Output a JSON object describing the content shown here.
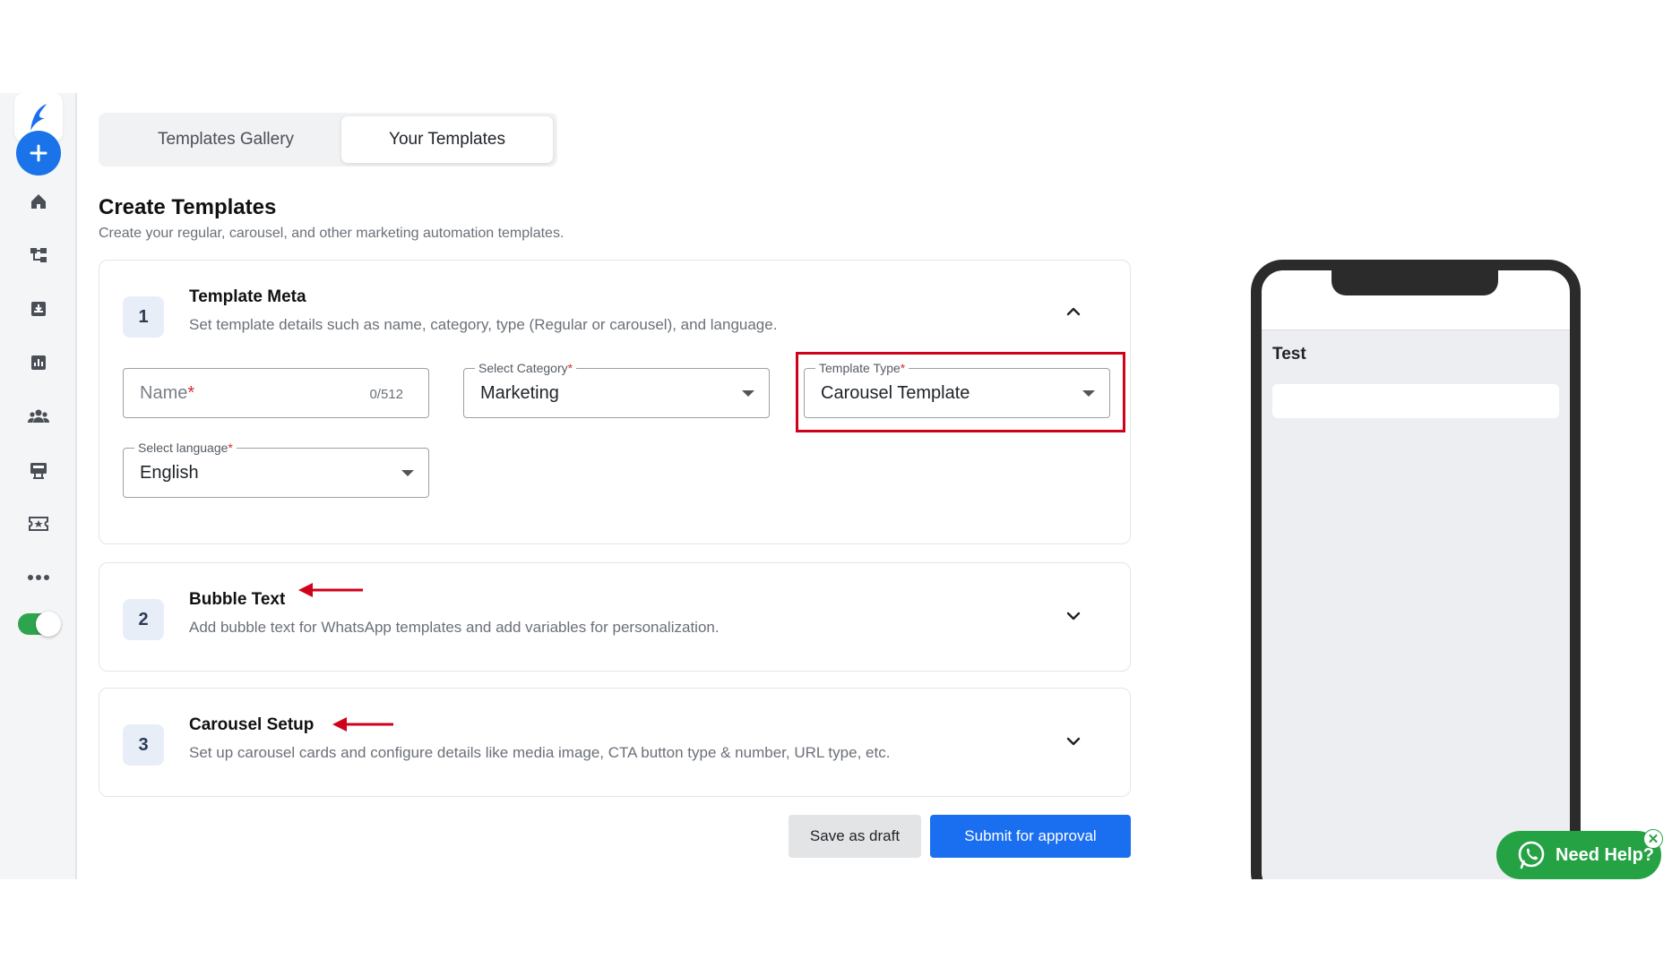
{
  "tabs": {
    "gallery": "Templates Gallery",
    "yours": "Your Templates"
  },
  "page": {
    "title": "Create Templates",
    "subtitle": "Create your regular, carousel, and other marketing automation templates."
  },
  "steps": [
    {
      "num": "1",
      "title": "Template Meta",
      "desc": "Set template details such as name, category, type (Regular or carousel), and language.",
      "expanded": true
    },
    {
      "num": "2",
      "title": "Bubble Text",
      "desc": "Add bubble text for WhatsApp templates and add variables for personalization.",
      "expanded": false
    },
    {
      "num": "3",
      "title": "Carousel Setup",
      "desc": "Set up carousel cards and configure details like media image, CTA button type & number, URL type, etc.",
      "expanded": false
    }
  ],
  "form": {
    "name": {
      "placeholder": "Name",
      "required_mark": "*",
      "counter": "0/512"
    },
    "category": {
      "label": "Select Category",
      "required_mark": "*",
      "value": "Marketing"
    },
    "type": {
      "label": "Template Type",
      "required_mark": "*",
      "value": "Carousel Template"
    },
    "language": {
      "label": "Select language",
      "required_mark": "*",
      "value": "English"
    }
  },
  "buttons": {
    "draft": "Save as draft",
    "submit": "Submit for approval"
  },
  "preview": {
    "title": "Test"
  },
  "help": {
    "label": "Need Help?",
    "close": "✕"
  },
  "sidebar": {
    "items": [
      "home-icon",
      "flow-icon",
      "inbox-icon",
      "analytics-icon",
      "contacts-icon",
      "campaign-icon",
      "tickets-icon",
      "more-icon"
    ],
    "toggle_on": true
  },
  "colors": {
    "accent": "#1a6ef0",
    "highlight": "#d0021b",
    "whatsapp": "#25a244"
  }
}
